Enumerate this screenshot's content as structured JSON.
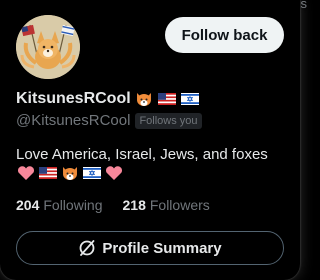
{
  "profile": {
    "display_name": "KitsunesRCool",
    "handle": "@KitsunesRCool",
    "follows_you_badge": "Follows you",
    "bio": "Love America, Israel, Jews, and foxes",
    "follow_back_label": "Follow back",
    "profile_summary_label": "Profile Summary",
    "name_emojis": [
      "fox-emoji",
      "us-flag-emoji",
      "israel-flag-emoji"
    ],
    "bio_emojis": [
      "pink-heart-emoji",
      "us-flag-emoji",
      "fox-emoji",
      "israel-flag-emoji",
      "pink-heart-emoji"
    ]
  },
  "stats": {
    "following_count": "204",
    "following_label": "Following",
    "followers_count": "218",
    "followers_label": "Followers"
  },
  "colors": {
    "background": "#000000",
    "primary_text": "#e7e9ea",
    "secondary_text": "#71767b",
    "follow_button_bg": "#eff3f4",
    "border": "#536471"
  }
}
